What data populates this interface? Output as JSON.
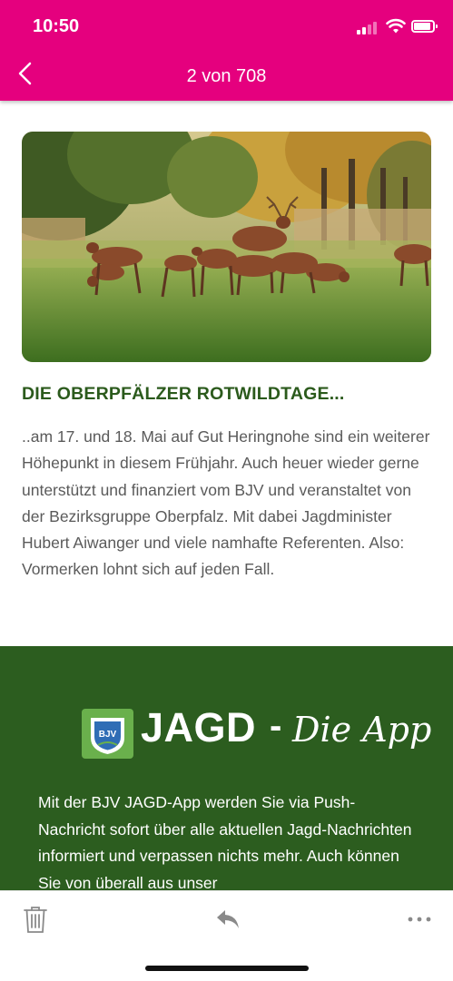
{
  "status_bar": {
    "time": "10:50"
  },
  "header": {
    "title": "2 von 708",
    "background": "#e5007e"
  },
  "article": {
    "headline": "DIE OBERPFÄLZER ROTWILDTAGE...",
    "body": "..am 17. und 18. Mai auf Gut Heringnohe sind ein weiterer Höhepunkt in diesem Frühjahr. Auch heuer wieder gerne unterstützt und finanziert vom BJV und veranstaltet von der Bezirksgruppe Oberpfalz. Mit dabei Jagdminister Hubert Aiwanger und viele namhafte Referenten. Also: Vormerken lohnt sich auf jeden Fall.",
    "headline_color": "#2b5a1c"
  },
  "promo": {
    "logo_badge": "BJV",
    "logo_word": "JAGD",
    "logo_dash": "-",
    "logo_script": "Die App",
    "text": "Mit der BJV JAGD-App werden Sie via Push-Nachricht sofort über alle aktuellen Jagd-Nachrichten informiert und verpassen nichts mehr. Auch können Sie von überall aus unser",
    "background": "#2c5d1f"
  },
  "toolbar": {
    "icons": [
      "trash-icon",
      "reply-icon",
      "more-icon"
    ]
  }
}
